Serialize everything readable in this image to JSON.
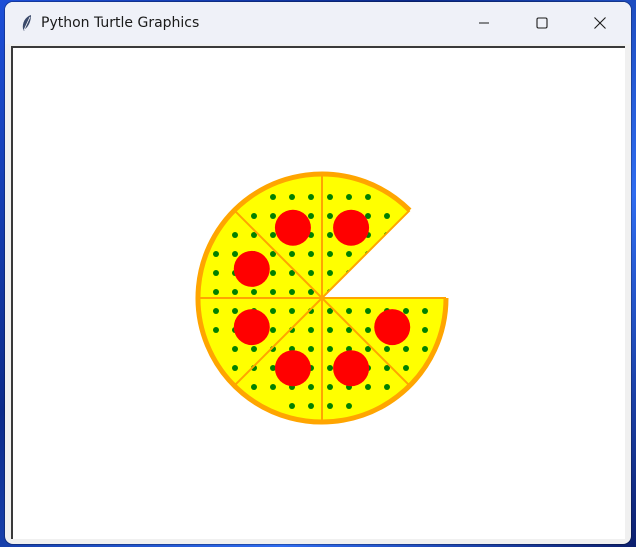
{
  "window": {
    "title": "Python Turtle Graphics",
    "icon": "feather-icon"
  },
  "controls": {
    "minimize": "minimize-icon",
    "maximize": "maximize-icon",
    "close": "close-icon"
  },
  "colors": {
    "desktop": "#1d4fd8",
    "titlebar": "#eff1f8",
    "canvas": "#ffffff",
    "pizza_fill": "#ffff00",
    "pizza_crust": "#ffa500",
    "pepperoni": "#ff0000",
    "herbs": "#008000"
  },
  "drawing": {
    "slices_total": 8,
    "slices_drawn": 7,
    "pepperoni_count": 7
  }
}
